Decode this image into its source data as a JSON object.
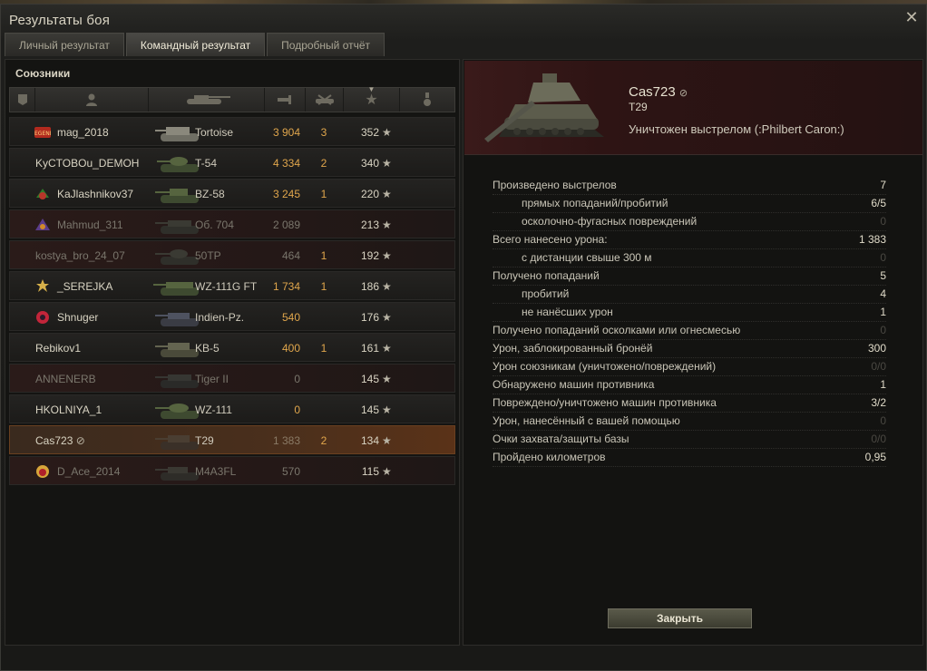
{
  "window": {
    "title": "Результаты боя"
  },
  "tabs": [
    {
      "label": "Личный результат",
      "active": false
    },
    {
      "label": "Командный результат",
      "active": true
    },
    {
      "label": "Подробный отчёт",
      "active": false
    }
  ],
  "allies": {
    "title": "Союзники",
    "columns": [
      "squad-icon",
      "player-icon",
      "vehicle-icon",
      "damage-icon",
      "kills-icon",
      "xp-star-icon",
      "medal-icon"
    ],
    "rows": [
      {
        "player": "mag_2018",
        "vehicle": "Tortoise",
        "damage": "3 904",
        "kills": "3",
        "xp": "352",
        "dead": false,
        "badge": "legend-badge"
      },
      {
        "player": "KyCTOBOu_DEMOH",
        "vehicle": "T-54",
        "damage": "4 334",
        "kills": "2",
        "xp": "340",
        "dead": false,
        "badge": ""
      },
      {
        "player": "KaJlashnikov37",
        "vehicle": "BZ-58",
        "damage": "3 245",
        "kills": "1",
        "xp": "220",
        "dead": false,
        "badge": "clan-badge"
      },
      {
        "player": "Mahmud_311",
        "vehicle": "Об. 704",
        "damage": "2 089",
        "kills": "",
        "xp": "213",
        "dead": true,
        "badge": "clan-badge"
      },
      {
        "player": "kostya_bro_24_07",
        "vehicle": "50TP",
        "damage": "464",
        "kills": "1",
        "xp": "192",
        "dead": true,
        "badge": ""
      },
      {
        "player": "_SEREJKA",
        "vehicle": "WZ-111G FT",
        "damage": "1 734",
        "kills": "1",
        "xp": "186",
        "dead": false,
        "badge": "clan-badge"
      },
      {
        "player": "Shnuger",
        "vehicle": "Indien-Pz.",
        "damage": "540",
        "kills": "",
        "xp": "176",
        "dead": false,
        "badge": "clan-badge"
      },
      {
        "player": "Rebikov1",
        "vehicle": "KB-5",
        "damage": "400",
        "kills": "1",
        "xp": "161",
        "dead": false,
        "badge": ""
      },
      {
        "player": "ANNENERB",
        "vehicle": "Tiger II",
        "damage": "0",
        "kills": "",
        "xp": "145",
        "dead": true,
        "badge": ""
      },
      {
        "player": "HKOLNIYA_1",
        "vehicle": "WZ-111",
        "damage": "0",
        "kills": "",
        "xp": "145",
        "dead": false,
        "badge": ""
      },
      {
        "player": "Cas723",
        "vehicle": "T29",
        "damage": "1 383",
        "kills": "2",
        "xp": "134",
        "dead": true,
        "self": true,
        "badge": "",
        "eye": "eye-off-icon"
      },
      {
        "player": "D_Ace_2014",
        "vehicle": "M4A3FL",
        "damage": "570",
        "kills": "",
        "xp": "115",
        "dead": true,
        "badge": "clan-badge"
      }
    ]
  },
  "detail": {
    "player": "Cas723",
    "tank": "T29",
    "killed_by": "Уничтожен выстрелом (:Philbert Caron:)",
    "stats": [
      {
        "label": "Произведено выстрелов",
        "value": "7",
        "indent": false,
        "dim": false
      },
      {
        "label": "прямых попаданий/пробитий",
        "value": "6/5",
        "indent": true,
        "dim": false
      },
      {
        "label": "осколочно-фугасных повреждений",
        "value": "0",
        "indent": true,
        "dim": true
      },
      {
        "label": "Всего нанесено урона:",
        "value": "1 383",
        "indent": false,
        "dim": false
      },
      {
        "label": "с дистанции свыше 300 м",
        "value": "0",
        "indent": true,
        "dim": true
      },
      {
        "label": "Получено попаданий",
        "value": "5",
        "indent": false,
        "dim": false
      },
      {
        "label": "пробитий",
        "value": "4",
        "indent": true,
        "dim": false
      },
      {
        "label": "не нанёсших урон",
        "value": "1",
        "indent": true,
        "dim": false
      },
      {
        "label": "Получено попаданий осколками или огнесмесью",
        "value": "0",
        "indent": false,
        "dim": true
      },
      {
        "label": "Урон, заблокированный бронёй",
        "value": "300",
        "indent": false,
        "dim": false
      },
      {
        "label": "Урон союзникам (уничтожено/повреждений)",
        "value": "0/0",
        "indent": false,
        "dim": true
      },
      {
        "label": "Обнаружено машин противника",
        "value": "1",
        "indent": false,
        "dim": false
      },
      {
        "label": "Повреждено/уничтожено машин противника",
        "value": "3/2",
        "indent": false,
        "dim": false
      },
      {
        "label": "Урон, нанесённый с вашей помощью",
        "value": "0",
        "indent": false,
        "dim": true
      },
      {
        "label": "Очки захвата/защиты базы",
        "value": "0/0",
        "indent": false,
        "dim": true
      },
      {
        "label": "Пройдено километров",
        "value": "0,95",
        "indent": false,
        "dim": false
      }
    ],
    "close_button": "Закрыть"
  }
}
